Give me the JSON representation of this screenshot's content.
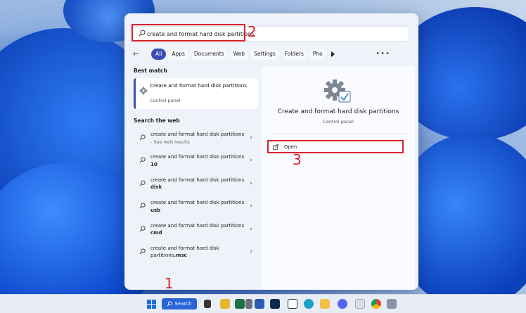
{
  "search": {
    "query": "create and format hard disk partitions"
  },
  "tabs": [
    "All",
    "Apps",
    "Documents",
    "Web",
    "Settings",
    "Folders",
    "Pho"
  ],
  "sections": {
    "best_match": "Best match",
    "search_web": "Search the web"
  },
  "best_match": {
    "title": "Create and format hard disk partitions",
    "subtitle": "Control panel"
  },
  "web_results": [
    {
      "prefix": "create and format hard disk partitions",
      "suffix": "",
      "muted": " - See web results"
    },
    {
      "prefix": "create and format hard disk partitions ",
      "suffix": "10",
      "muted": ""
    },
    {
      "prefix": "create and format hard disk partitions ",
      "suffix": "disk",
      "muted": ""
    },
    {
      "prefix": "create and format hard disk partitions ",
      "suffix": "usb",
      "muted": ""
    },
    {
      "prefix": "create and format hard disk partitions ",
      "suffix": "cmd",
      "muted": ""
    },
    {
      "prefix": "create and format hard disk partitions",
      "suffix": ".msc",
      "muted": ""
    }
  ],
  "preview": {
    "title": "Create and format hard disk partitions",
    "subtitle": "Control panel",
    "open_label": "Open"
  },
  "annotations": {
    "n1": "1",
    "n2": "2",
    "n3": "3"
  },
  "taskbar": {
    "search_label": "Search"
  },
  "colors": {
    "accent": "#3a4fb5",
    "annotation_red": "#d8222e",
    "taskbar_search": "#2b63d9"
  }
}
